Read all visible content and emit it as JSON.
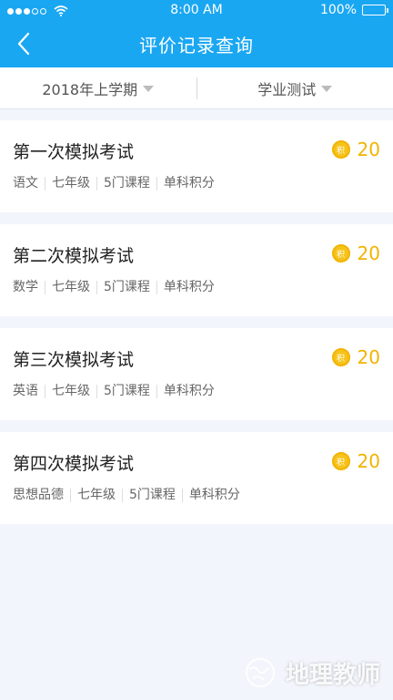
{
  "status_bar": {
    "time": "8:00 AM",
    "battery": "100%"
  },
  "navbar": {
    "title": "评价记录查询",
    "back_icon": "chevron-left-icon"
  },
  "filters": [
    {
      "label": "2018年上学期"
    },
    {
      "label": "学业测试"
    }
  ],
  "records": [
    {
      "title": "第一次模拟考试",
      "score": "20",
      "badge": "积",
      "tags": [
        "语文",
        "七年级",
        "5门课程",
        "单科积分"
      ]
    },
    {
      "title": "第二次模拟考试",
      "score": "20",
      "badge": "积",
      "tags": [
        "数学",
        "七年级",
        "5门课程",
        "单科积分"
      ]
    },
    {
      "title": "第三次模拟考试",
      "score": "20",
      "badge": "积",
      "tags": [
        "英语",
        "七年级",
        "5门课程",
        "单科积分"
      ]
    },
    {
      "title": "第四次模拟考试",
      "score": "20",
      "badge": "积",
      "tags": [
        "思想品德",
        "七年级",
        "5门课程",
        "单科积分"
      ]
    }
  ],
  "watermark": {
    "text": "地理教师"
  },
  "colors": {
    "header": "#1aa7f2",
    "score": "#f0b400",
    "background": "#f2f5fb"
  }
}
